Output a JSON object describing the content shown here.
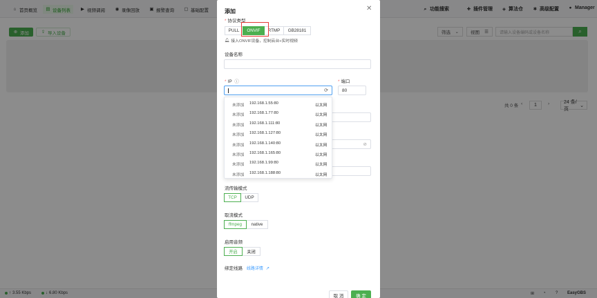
{
  "nav": {
    "items": [
      {
        "label": "首页概览",
        "icon": "home-icon"
      },
      {
        "label": "设备列表",
        "icon": "list-icon"
      },
      {
        "label": "视频调阅",
        "icon": "play-icon"
      },
      {
        "label": "录像回放",
        "icon": "record-icon"
      },
      {
        "label": "报警查询",
        "icon": "alarm-icon"
      },
      {
        "label": "基础配置",
        "icon": "config-icon"
      }
    ],
    "right": [
      {
        "label": "功能搜索",
        "icon": "search-icon"
      },
      {
        "label": "插件管理",
        "icon": "puzzle-icon"
      },
      {
        "label": "算法仓",
        "icon": "package-icon"
      },
      {
        "label": "高级配置",
        "icon": "gear-icon"
      },
      {
        "label": "Manager",
        "icon": "user-icon"
      }
    ]
  },
  "toolbar": {
    "add_label": "添加",
    "import_label": "导入设备",
    "filter_label": "筛选",
    "view_label": "视图",
    "search_placeholder": "请输入设备编码或设备名称"
  },
  "pager": {
    "total": "共 0 条",
    "page": "1",
    "page_size": "24 条/页"
  },
  "footer": {
    "up_speed": "3.55 Kbps",
    "down_speed": "6.80 Kbps",
    "brand": "EasyGBS"
  },
  "modal": {
    "title": "添加",
    "protocol_label": "协议类型",
    "protocols": [
      "PULL",
      "ONVIF",
      "RTMP",
      "GB28181"
    ],
    "selected_protocol": "ONVIF",
    "protocol_hint": "接入ONVIF设备，控制云台+实时视频",
    "device_name_label": "设备名称",
    "device_name_value": "",
    "ip_label": "IP",
    "ip_value": "",
    "port_label": "端口",
    "port_value": "80",
    "stream_transport_label": "流传输模式",
    "stream_transport_options": [
      "TCP",
      "UDP"
    ],
    "stream_transport_selected": "TCP",
    "pull_mode_label": "取流模式",
    "pull_mode_options": [
      "ffmpeg",
      "native"
    ],
    "pull_mode_selected": "ffmpeg",
    "audio_label": "启用音频",
    "audio_options": [
      "开启",
      "关闭"
    ],
    "audio_selected": "开启",
    "bind_route_label": "绑定线路",
    "bind_route_link": "线路详情",
    "cancel_label": "取 消",
    "ok_label": "确 定"
  },
  "dropdown": {
    "items": [
      {
        "status": "未添加",
        "ip": "192.168.1.55:80",
        "type": "以太网"
      },
      {
        "status": "未添加",
        "ip": "192.168.1.77:80",
        "type": "以太网"
      },
      {
        "status": "未添加",
        "ip": "192.168.1.111:80",
        "type": "以太网"
      },
      {
        "status": "未添加",
        "ip": "192.168.1.127:80",
        "type": "以太网"
      },
      {
        "status": "未添加",
        "ip": "192.168.1.140:80",
        "type": "以太网"
      },
      {
        "status": "未添加",
        "ip": "192.168.1.165:80",
        "type": "以太网"
      },
      {
        "status": "未添加",
        "ip": "192.168.1.99:80",
        "type": "以太网"
      },
      {
        "status": "未添加",
        "ip": "192.168.1.188:80",
        "type": "以太网"
      }
    ]
  },
  "colors": {
    "accent": "#4caf50",
    "highlight": "#e53935",
    "focus": "#4f9ff0"
  }
}
